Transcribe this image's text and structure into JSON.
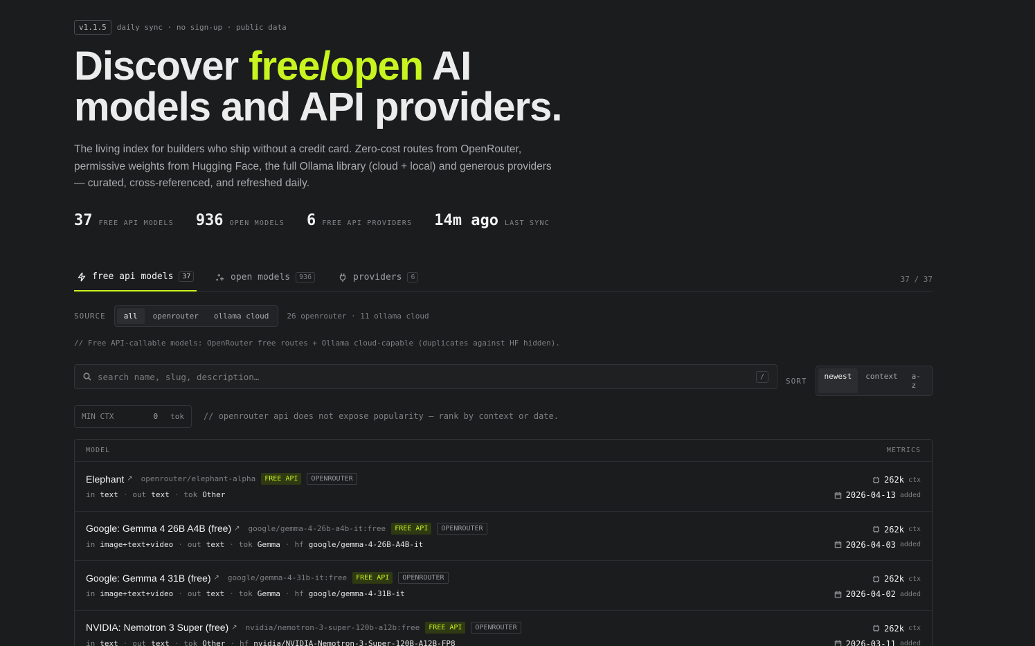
{
  "meta": {
    "version": "v1.1.5",
    "text": "daily sync · no sign-up · public data"
  },
  "hero": {
    "title_pre": "Discover ",
    "title_accent": "free/open",
    "title_post_1": " AI",
    "title_line2": "models and API providers.",
    "lede": "The living index for builders who ship without a credit card. Zero-cost routes from OpenRouter, permissive weights from Hugging Face, the full Ollama library (cloud + local) and generous providers — curated, cross-referenced, and refreshed daily."
  },
  "stats": [
    {
      "num": "37",
      "label": "FREE API MODELS"
    },
    {
      "num": "936",
      "label": "OPEN MODELS"
    },
    {
      "num": "6",
      "label": "FREE API PROVIDERS"
    },
    {
      "num": "14m ago",
      "label": "LAST SYNC"
    }
  ],
  "tabs": [
    {
      "label": "free api models",
      "count": "37",
      "icon": "bolt-icon"
    },
    {
      "label": "open models",
      "count": "936",
      "icon": "sparkles-icon"
    },
    {
      "label": "providers",
      "count": "6",
      "icon": "plug-icon"
    }
  ],
  "count_right": "37 / 37",
  "source": {
    "label": "SOURCE",
    "options": [
      "all",
      "openrouter",
      "ollama cloud"
    ],
    "selected": "all",
    "note": "26 openrouter · 11 ollama cloud"
  },
  "comment": "// Free API-callable models: OpenRouter free routes + Ollama cloud-capable (duplicates against HF hidden).",
  "search": {
    "placeholder": "search name, slug, description…",
    "shortcut": "/"
  },
  "sort": {
    "label": "SORT",
    "options": [
      "newest",
      "context",
      "a-z"
    ],
    "selected": "newest"
  },
  "minctx": {
    "label": "MIN CTX",
    "value": "0",
    "unit": "tok",
    "note": "// openrouter api does not expose popularity — rank by context or date."
  },
  "table": {
    "col_model": "MODEL",
    "col_metrics": "METRICS",
    "rows": [
      {
        "name": "Elephant",
        "slug": "openrouter/elephant-alpha",
        "tag": "FREE API",
        "provider": "OPENROUTER",
        "in": "text",
        "out": "text",
        "tok": "Other",
        "hf": "",
        "ctx": "262k",
        "added": "2026-04-13"
      },
      {
        "name": "Google: Gemma 4 26B A4B (free)",
        "slug": "google/gemma-4-26b-a4b-it:free",
        "tag": "FREE API",
        "provider": "OPENROUTER",
        "in": "image+text+video",
        "out": "text",
        "tok": "Gemma",
        "hf": "google/gemma-4-26B-A4B-it",
        "ctx": "262k",
        "added": "2026-04-03"
      },
      {
        "name": "Google: Gemma 4 31B (free)",
        "slug": "google/gemma-4-31b-it:free",
        "tag": "FREE API",
        "provider": "OPENROUTER",
        "in": "image+text+video",
        "out": "text",
        "tok": "Gemma",
        "hf": "google/gemma-4-31B-it",
        "ctx": "262k",
        "added": "2026-04-02"
      },
      {
        "name": "NVIDIA: Nemotron 3 Super (free)",
        "slug": "nvidia/nemotron-3-super-120b-a12b:free",
        "tag": "FREE API",
        "provider": "OPENROUTER",
        "in": "text",
        "out": "text",
        "tok": "Other",
        "hf": "nvidia/NVIDIA-Nemotron-3-Super-120B-A12B-FP8",
        "ctx": "262k",
        "added": "2026-03-11"
      }
    ],
    "labels": {
      "in": "in",
      "out": "out",
      "tok": "tok",
      "hf": "hf",
      "ctx": "ctx",
      "added": "added"
    }
  },
  "colors": {
    "accent": "#c8f520",
    "background": "#1b1c1e"
  }
}
